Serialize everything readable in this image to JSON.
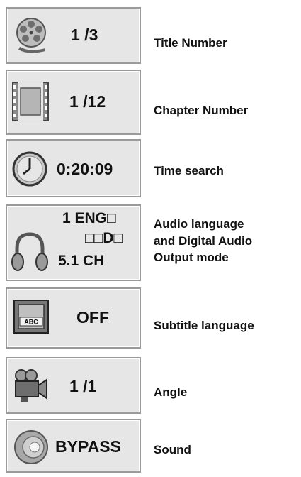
{
  "items": [
    {
      "icon": "film-reel-icon",
      "value": "1 /3",
      "label": "Title Number"
    },
    {
      "icon": "film-strip-icon",
      "value": "1 /12",
      "label": "Chapter Number"
    },
    {
      "icon": "clock-icon",
      "value": "0:20:09",
      "label": "Time search"
    },
    {
      "icon": "headphones-icon",
      "value_lines": [
        "1 ENG□",
        "□□D□",
        "5.1 CH"
      ],
      "label_lines": [
        "Audio language",
        "and Digital Audio",
        "Output mode"
      ]
    },
    {
      "icon": "subtitle-tv-icon",
      "icon_text": "ABC",
      "value": "OFF",
      "label": "Subtitle language"
    },
    {
      "icon": "camera-angle-icon",
      "value": "1 /1",
      "label": "Angle"
    },
    {
      "icon": "speaker-icon",
      "value": "BYPASS",
      "label": "Sound"
    }
  ]
}
